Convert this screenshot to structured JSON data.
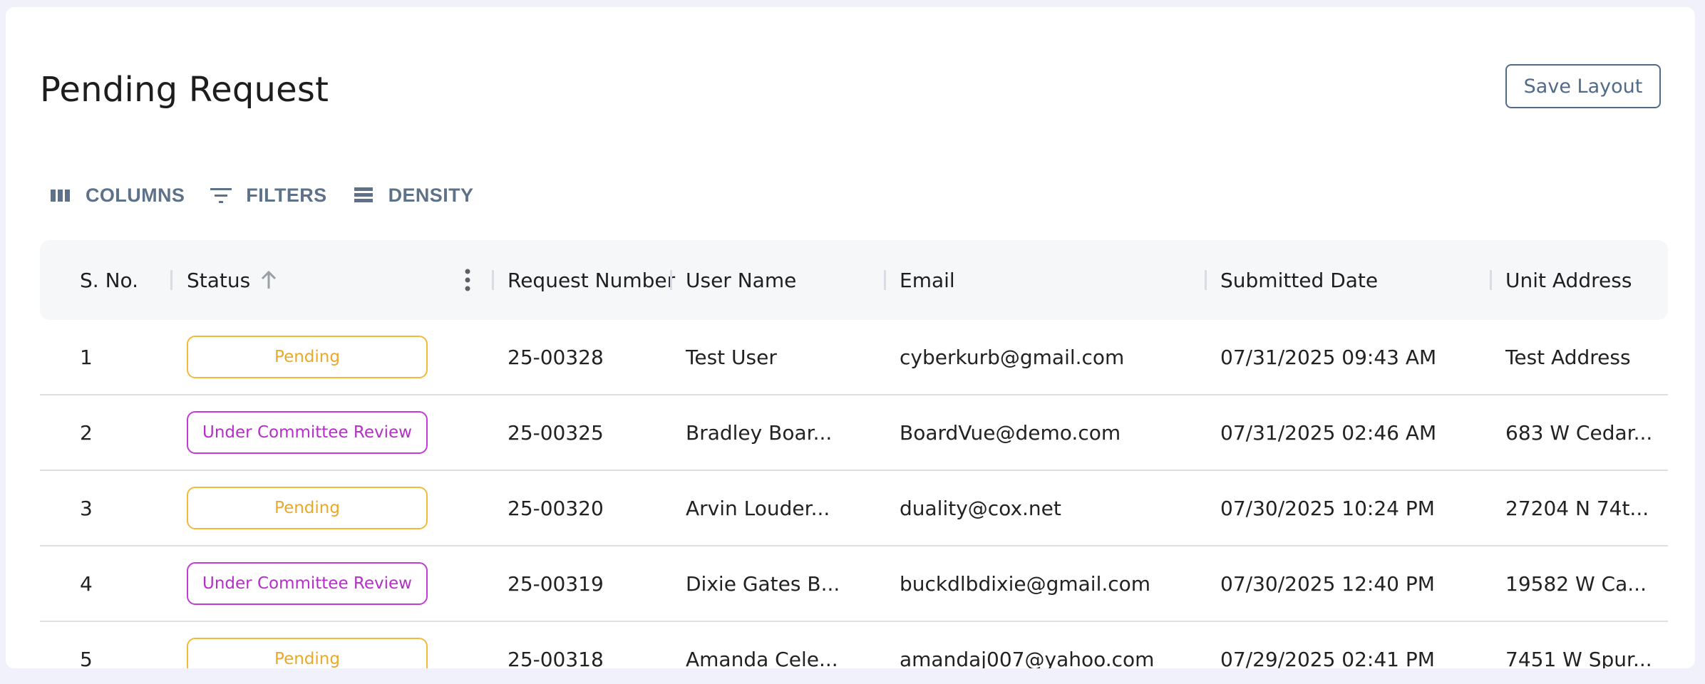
{
  "page": {
    "title": "Pending Request"
  },
  "actions": {
    "save_layout": "Save Layout"
  },
  "toolbar": {
    "columns": "COLUMNS",
    "filters": "FILTERS",
    "density": "DENSITY"
  },
  "table": {
    "columns": [
      "S. No.",
      "Status",
      "Request Number",
      "User Name",
      "Email",
      "Submitted Date",
      "Unit Address"
    ],
    "sort": {
      "column": "Status",
      "direction": "ascending"
    },
    "rows": [
      {
        "sno": "1",
        "status": "Pending",
        "status_type": "pending",
        "request": "25-00328",
        "user": "Test User",
        "email": "cyberkurb@gmail.com",
        "date": "07/31/2025 09:43 AM",
        "address": "Test Address"
      },
      {
        "sno": "2",
        "status": "Under Committee Review",
        "status_type": "review",
        "request": "25-00325",
        "user": "Bradley Boar...",
        "email": "BoardVue@demo.com",
        "date": "07/31/2025 02:46 AM",
        "address": "683 W Cedar..."
      },
      {
        "sno": "3",
        "status": "Pending",
        "status_type": "pending",
        "request": "25-00320",
        "user": "Arvin Louder...",
        "email": "duality@cox.net",
        "date": "07/30/2025 10:24 PM",
        "address": "27204 N 74t..."
      },
      {
        "sno": "4",
        "status": "Under Committee Review",
        "status_type": "review",
        "request": "25-00319",
        "user": "Dixie Gates B...",
        "email": "buckdlbdixie@gmail.com",
        "date": "07/30/2025 12:40 PM",
        "address": "19582 W Ca..."
      },
      {
        "sno": "5",
        "status": "Pending",
        "status_type": "pending",
        "request": "25-00318",
        "user": "Amanda Cele...",
        "email": "amandaj007@yahoo.com",
        "date": "07/29/2025 02:41 PM",
        "address": "7451 W Spur..."
      }
    ]
  },
  "colors": {
    "pending": "#eaa92a",
    "review": "#b62ec9",
    "accent": "#516a86"
  },
  "icons": {
    "columns": "columns-icon",
    "filters": "filter-icon",
    "density": "density-icon",
    "sort": "arrow-up-icon",
    "menu": "more-vertical-icon"
  }
}
